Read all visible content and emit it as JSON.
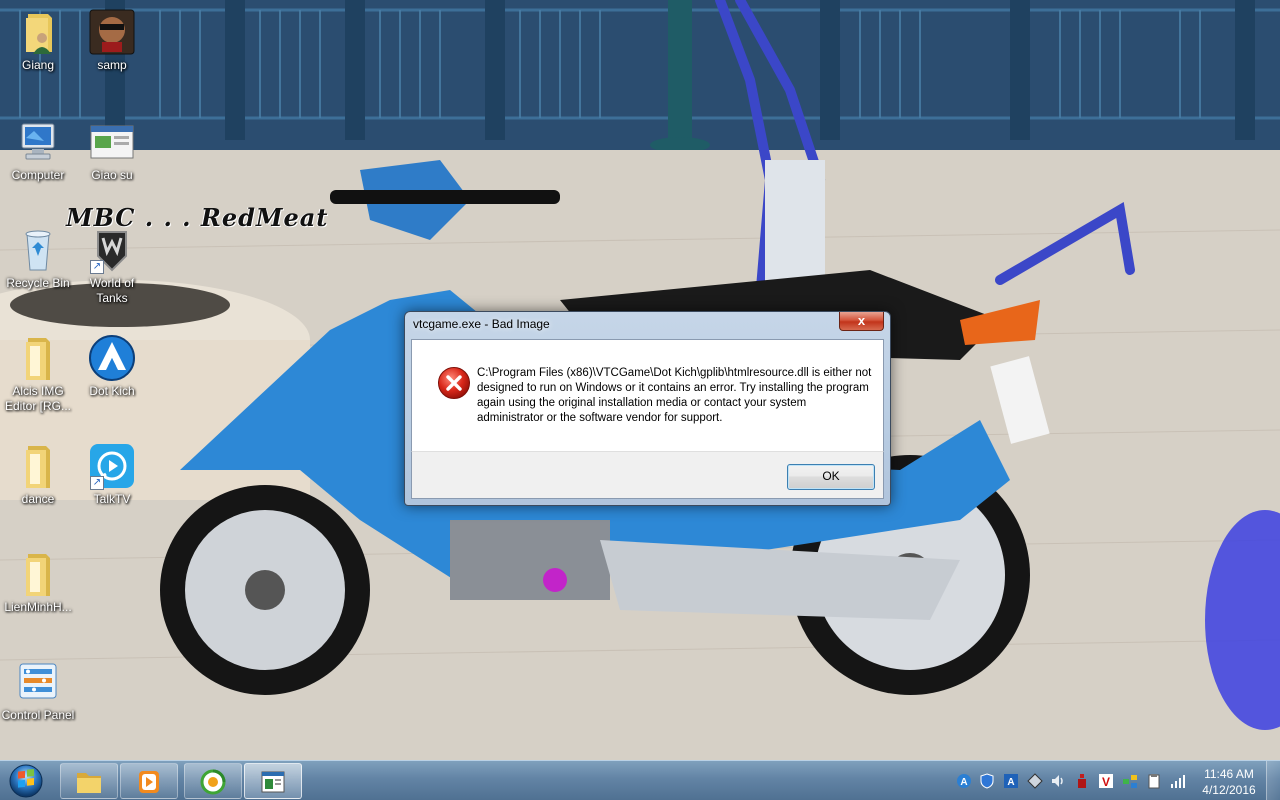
{
  "desktop": {
    "icons": [
      {
        "label": "Giang",
        "icon": "user-folder-icon"
      },
      {
        "label": "samp",
        "icon": "samp-game-icon"
      },
      {
        "label": "Computer",
        "icon": "computer-icon"
      },
      {
        "label": "Giao su",
        "icon": "giao-su-icon"
      },
      {
        "label": "Recycle Bin",
        "icon": "recycle-bin-icon"
      },
      {
        "label": "World of Tanks",
        "icon": "world-of-tanks-icon"
      },
      {
        "label": "Alcis IMG Editor [RG...",
        "icon": "folder-icon"
      },
      {
        "label": "Dot Kich",
        "icon": "dot-kich-icon"
      },
      {
        "label": "dance",
        "icon": "folder-icon"
      },
      {
        "label": "TalkTV",
        "icon": "talktv-icon"
      },
      {
        "label": "LienMinhH...",
        "icon": "folder-icon"
      },
      {
        "label": "Control Panel",
        "icon": "control-panel-icon"
      }
    ],
    "watermark": "MBC . . . RedMeat"
  },
  "dialog": {
    "title": "vtcgame.exe - Bad Image",
    "close_label": "x",
    "message": "C:\\Program Files (x86)\\VTCGame\\Dot Kich\\gplib\\htmlresource.dll is either not designed to run on Windows or it contains an error. Try installing the program again using the original installation media or contact your system administrator or the software vendor for support.",
    "ok_label": "OK",
    "icon": "error-icon"
  },
  "taskbar": {
    "start": "start-orb-icon",
    "pinned": [
      {
        "name": "file-explorer",
        "icon": "folder-icon"
      },
      {
        "name": "media-player",
        "icon": "media-player-icon"
      },
      {
        "name": "coc-coc-browser",
        "icon": "browser-icon"
      },
      {
        "name": "vtcgame-window",
        "icon": "app-window-icon",
        "active": true
      }
    ],
    "tray": [
      "A",
      "shield",
      "A",
      "diamond",
      "speaker",
      "bottle",
      "V",
      "network",
      "clipboard",
      "signal"
    ],
    "time": "11:46 AM",
    "date": "4/12/2016"
  },
  "colors": {
    "dialog_frame": "#b8cce2",
    "close_button": "#c2341b",
    "error_red": "#d9281a",
    "taskbar": "#5a7da0"
  }
}
